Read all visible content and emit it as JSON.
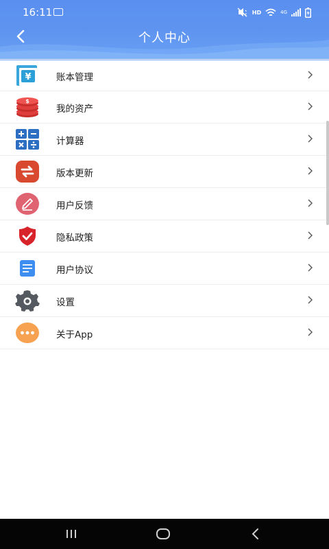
{
  "status_bar": {
    "time": "16:11",
    "hd": "HD",
    "network": "4G"
  },
  "header": {
    "title": "个人中心"
  },
  "menu": {
    "items": [
      {
        "label": "账本管理",
        "icon": "ledger-icon"
      },
      {
        "label": "我的资产",
        "icon": "coins-icon"
      },
      {
        "label": "计算器",
        "icon": "calculator-icon"
      },
      {
        "label": "版本更新",
        "icon": "refresh-icon"
      },
      {
        "label": "用户反馈",
        "icon": "pencil-icon"
      },
      {
        "label": "隐私政策",
        "icon": "shield-check-icon"
      },
      {
        "label": "用户协议",
        "icon": "document-icon"
      },
      {
        "label": "设置",
        "icon": "gear-icon"
      },
      {
        "label": "关于App",
        "icon": "more-dots-icon"
      }
    ]
  },
  "colors": {
    "header": "#5f95f0",
    "ledger": "#2a9fd8",
    "coins": "#e0403d",
    "calculator": "#2c6fc2",
    "refresh": "#d8492f",
    "pencil": "#e06372",
    "shield": "#d8232a",
    "document": "#3d8ef0",
    "gear": "#555a60",
    "more": "#f7a250"
  },
  "nav": {
    "recent": "recent-apps-icon",
    "home": "home-icon",
    "back": "back-icon"
  }
}
